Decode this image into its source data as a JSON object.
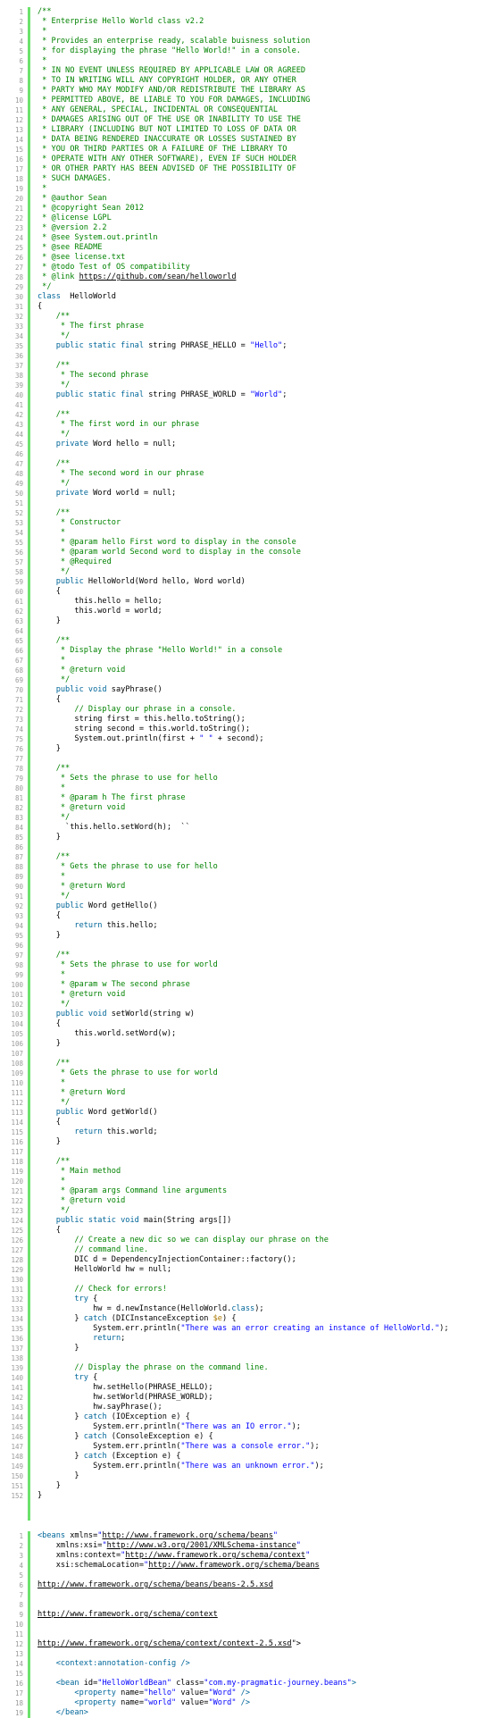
{
  "theme": {
    "gutter_bar": "#6ce26c",
    "line_number": "#9a9a9a",
    "comment": "#008200",
    "keyword": "#006699",
    "string": "#0000ff",
    "variable": "#aa7700"
  },
  "java": {
    "language": "java",
    "lines": [
      [
        [
          "cm",
          "/**"
        ]
      ],
      [
        [
          "cm",
          " * Enterprise Hello World class v2.2"
        ]
      ],
      [
        [
          "cm",
          " *"
        ]
      ],
      [
        [
          "cm",
          " * Provides an enterprise ready, scalable buisness solution"
        ]
      ],
      [
        [
          "cm",
          " * for displaying the phrase \"Hello World!\" in a console."
        ]
      ],
      [
        [
          "cm",
          " *"
        ]
      ],
      [
        [
          "cm",
          " * IN NO EVENT UNLESS REQUIRED BY APPLICABLE LAW OR AGREED"
        ]
      ],
      [
        [
          "cm",
          " * TO IN WRITING WILL ANY COPYRIGHT HOLDER, OR ANY OTHER"
        ]
      ],
      [
        [
          "cm",
          " * PARTY WHO MAY MODIFY AND/OR REDISTRIBUTE THE LIBRARY AS"
        ]
      ],
      [
        [
          "cm",
          " * PERMITTED ABOVE, BE LIABLE TO YOU FOR DAMAGES, INCLUDING"
        ]
      ],
      [
        [
          "cm",
          " * ANY GENERAL, SPECIAL, INCIDENTAL OR CONSEQUENTIAL"
        ]
      ],
      [
        [
          "cm",
          " * DAMAGES ARISING OUT OF THE USE OR INABILITY TO USE THE"
        ]
      ],
      [
        [
          "cm",
          " * LIBRARY (INCLUDING BUT NOT LIMITED TO LOSS OF DATA OR"
        ]
      ],
      [
        [
          "cm",
          " * DATA BEING RENDERED INACCURATE OR LOSSES SUSTAINED BY"
        ]
      ],
      [
        [
          "cm",
          " * YOU OR THIRD PARTIES OR A FAILURE OF THE LIBRARY TO"
        ]
      ],
      [
        [
          "cm",
          " * OPERATE WITH ANY OTHER SOFTWARE), EVEN IF SUCH HOLDER"
        ]
      ],
      [
        [
          "cm",
          " * OR OTHER PARTY HAS BEEN ADVISED OF THE POSSIBILITY OF"
        ]
      ],
      [
        [
          "cm",
          " * SUCH DAMAGES."
        ]
      ],
      [
        [
          "cm",
          " *"
        ]
      ],
      [
        [
          "cm",
          " * @author Sean"
        ]
      ],
      [
        [
          "cm",
          " * @copyright Sean 2012"
        ]
      ],
      [
        [
          "cm",
          " * @license LGPL"
        ]
      ],
      [
        [
          "cm",
          " * @version 2.2"
        ]
      ],
      [
        [
          "cm",
          " * @see System.out.println"
        ]
      ],
      [
        [
          "cm",
          " * @see README"
        ]
      ],
      [
        [
          "cm",
          " * @see license.txt"
        ]
      ],
      [
        [
          "cm",
          " * @todo Test of OS compatibility"
        ]
      ],
      [
        [
          "cm",
          " * @link "
        ],
        [
          "lk",
          "https://github.com/sean/helloworld"
        ]
      ],
      [
        [
          "cm",
          " */"
        ]
      ],
      [
        [
          "kw",
          "class"
        ],
        [
          "",
          "  HelloWorld"
        ]
      ],
      [
        [
          "",
          "{"
        ]
      ],
      [
        [
          "cm",
          "    /**"
        ]
      ],
      [
        [
          "cm",
          "     * The first phrase"
        ]
      ],
      [
        [
          "cm",
          "     */"
        ]
      ],
      [
        [
          "kw",
          "    public static final "
        ],
        [
          "",
          "string PHRASE_HELLO = "
        ],
        [
          "st",
          "\"Hello\""
        ],
        [
          "",
          ";"
        ]
      ],
      [
        [
          "",
          ""
        ]
      ],
      [
        [
          "cm",
          "    /**"
        ]
      ],
      [
        [
          "cm",
          "     * The second phrase"
        ]
      ],
      [
        [
          "cm",
          "     */"
        ]
      ],
      [
        [
          "kw",
          "    public static final "
        ],
        [
          "",
          "string PHRASE_WORLD = "
        ],
        [
          "st",
          "\"World\""
        ],
        [
          "",
          ";"
        ]
      ],
      [
        [
          "",
          ""
        ]
      ],
      [
        [
          "cm",
          "    /**"
        ]
      ],
      [
        [
          "cm",
          "     * The first word in our phrase"
        ]
      ],
      [
        [
          "cm",
          "     */"
        ]
      ],
      [
        [
          "kw",
          "    private "
        ],
        [
          "",
          "Word hello = null;"
        ]
      ],
      [
        [
          "",
          ""
        ]
      ],
      [
        [
          "cm",
          "    /**"
        ]
      ],
      [
        [
          "cm",
          "     * The second word in our phrase"
        ]
      ],
      [
        [
          "cm",
          "     */"
        ]
      ],
      [
        [
          "kw",
          "    private "
        ],
        [
          "",
          "Word world = null;"
        ]
      ],
      [
        [
          "",
          ""
        ]
      ],
      [
        [
          "cm",
          "    /**"
        ]
      ],
      [
        [
          "cm",
          "     * Constructor"
        ]
      ],
      [
        [
          "cm",
          "     *"
        ]
      ],
      [
        [
          "cm",
          "     * @param hello First word to display in the console"
        ]
      ],
      [
        [
          "cm",
          "     * @param world Second word to display in the console"
        ]
      ],
      [
        [
          "cm",
          "     * @Required"
        ]
      ],
      [
        [
          "cm",
          "     */"
        ]
      ],
      [
        [
          "kw",
          "    public "
        ],
        [
          "",
          "HelloWorld(Word hello, Word world)"
        ]
      ],
      [
        [
          "",
          "    {"
        ]
      ],
      [
        [
          "",
          "        this.hello = hello;"
        ]
      ],
      [
        [
          "",
          "        this.world = world;"
        ]
      ],
      [
        [
          "",
          "    }"
        ]
      ],
      [
        [
          "",
          ""
        ]
      ],
      [
        [
          "cm",
          "    /**"
        ]
      ],
      [
        [
          "cm",
          "     * Display the phrase \"Hello World!\" in a console"
        ]
      ],
      [
        [
          "cm",
          "     *"
        ]
      ],
      [
        [
          "cm",
          "     * @return void"
        ]
      ],
      [
        [
          "cm",
          "     */"
        ]
      ],
      [
        [
          "kw",
          "    public void "
        ],
        [
          "",
          "sayPhrase()"
        ]
      ],
      [
        [
          "",
          "    {"
        ]
      ],
      [
        [
          "cm",
          "        // Display our phrase in a console."
        ]
      ],
      [
        [
          "",
          "        string first = this.hello.toString();"
        ]
      ],
      [
        [
          "",
          "        string second = this.world.toString();"
        ]
      ],
      [
        [
          "",
          "        System.out.println(first + "
        ],
        [
          "st",
          "\" \""
        ],
        [
          "",
          "",
          " + second);"
        ]
      ],
      [
        [
          "",
          "    }"
        ]
      ],
      [
        [
          "",
          ""
        ]
      ],
      [
        [
          "cm",
          "    /**"
        ]
      ],
      [
        [
          "cm",
          "     * Sets the phrase to use for hello"
        ]
      ],
      [
        [
          "cm",
          "     *"
        ]
      ],
      [
        [
          "cm",
          "     * @param h The first phrase"
        ]
      ],
      [
        [
          "cm",
          "     * @return void"
        ]
      ],
      [
        [
          "cm",
          "     */"
        ]
      ],
      [
        [
          "",
          "      `this.hello.setWord(h);  ``"
        ]
      ],
      [
        [
          "",
          "    }"
        ]
      ],
      [
        [
          "",
          ""
        ]
      ],
      [
        [
          "cm",
          "    /**"
        ]
      ],
      [
        [
          "cm",
          "     * Gets the phrase to use for hello"
        ]
      ],
      [
        [
          "cm",
          "     *"
        ]
      ],
      [
        [
          "cm",
          "     * @return Word"
        ]
      ],
      [
        [
          "cm",
          "     */"
        ]
      ],
      [
        [
          "kw",
          "    public "
        ],
        [
          "",
          "Word getHello()"
        ]
      ],
      [
        [
          "",
          "    {"
        ]
      ],
      [
        [
          "kw",
          "        return "
        ],
        [
          "",
          "this.hello;"
        ]
      ],
      [
        [
          "",
          "    }"
        ]
      ],
      [
        [
          "",
          ""
        ]
      ],
      [
        [
          "cm",
          "    /**"
        ]
      ],
      [
        [
          "cm",
          "     * Sets the phrase to use for world"
        ]
      ],
      [
        [
          "cm",
          "     *"
        ]
      ],
      [
        [
          "cm",
          "     * @param w The second phrase"
        ]
      ],
      [
        [
          "cm",
          "     * @return void"
        ]
      ],
      [
        [
          "cm",
          "     */"
        ]
      ],
      [
        [
          "kw",
          "    public void "
        ],
        [
          "",
          "setWorld(string w)"
        ]
      ],
      [
        [
          "",
          "    {"
        ]
      ],
      [
        [
          "",
          "        this.world.setWord(w);"
        ]
      ],
      [
        [
          "",
          "    }"
        ]
      ],
      [
        [
          "",
          ""
        ]
      ],
      [
        [
          "cm",
          "    /**"
        ]
      ],
      [
        [
          "cm",
          "     * Gets the phrase to use for world"
        ]
      ],
      [
        [
          "cm",
          "     *"
        ]
      ],
      [
        [
          "cm",
          "     * @return Word"
        ]
      ],
      [
        [
          "cm",
          "     */"
        ]
      ],
      [
        [
          "kw",
          "    public "
        ],
        [
          "",
          "Word getWorld()"
        ]
      ],
      [
        [
          "",
          "    {"
        ]
      ],
      [
        [
          "kw",
          "        return "
        ],
        [
          "",
          "this.world;"
        ]
      ],
      [
        [
          "",
          "    }"
        ]
      ],
      [
        [
          "",
          ""
        ]
      ],
      [
        [
          "cm",
          "    /**"
        ]
      ],
      [
        [
          "cm",
          "     * Main method"
        ]
      ],
      [
        [
          "cm",
          "     *"
        ]
      ],
      [
        [
          "cm",
          "     * @param args Command line arguments"
        ]
      ],
      [
        [
          "cm",
          "     * @return void"
        ]
      ],
      [
        [
          "cm",
          "     */"
        ]
      ],
      [
        [
          "kw",
          "    public static void "
        ],
        [
          "",
          "main(String args[])"
        ]
      ],
      [
        [
          "",
          "    {"
        ]
      ],
      [
        [
          "cm",
          "        // Create a new dic so we can display our phrase on the"
        ]
      ],
      [
        [
          "cm",
          "        // command line."
        ]
      ],
      [
        [
          "",
          "        DIC d = DependencyInjectionContainer::factory();"
        ]
      ],
      [
        [
          "",
          "        HelloWorld hw = null;"
        ]
      ],
      [
        [
          "",
          ""
        ]
      ],
      [
        [
          "cm",
          "        // Check for errors!"
        ]
      ],
      [
        [
          "kw",
          "        try "
        ],
        [
          "",
          "{"
        ]
      ],
      [
        [
          "",
          "            hw = d.newInstance(HelloWorld."
        ],
        [
          "kw",
          "class"
        ],
        [
          "",
          ");"
        ]
      ],
      [
        [
          "",
          "        } "
        ],
        [
          "kw",
          "catch"
        ],
        [
          "",
          " (DICInstanceException "
        ],
        [
          "vr",
          "$e"
        ],
        [
          "",
          ") {"
        ]
      ],
      [
        [
          "",
          "            System.err.println("
        ],
        [
          "st",
          "\"There was an error creating an instance of HelloWorld.\""
        ],
        [
          "",
          ");"
        ]
      ],
      [
        [
          "kw",
          "            return"
        ],
        [
          "",
          ";"
        ]
      ],
      [
        [
          "",
          "        }"
        ]
      ],
      [
        [
          "",
          ""
        ]
      ],
      [
        [
          "cm",
          "        // Display the phrase on the command line."
        ]
      ],
      [
        [
          "kw",
          "        try "
        ],
        [
          "",
          "{"
        ]
      ],
      [
        [
          "",
          "            hw.setHello(PHRASE_HELLO);"
        ]
      ],
      [
        [
          "",
          "            hw.setWorld(PHRASE_WORLD);"
        ]
      ],
      [
        [
          "",
          "            hw.sayPhrase();"
        ]
      ],
      [
        [
          "",
          "        } "
        ],
        [
          "kw",
          "catch"
        ],
        [
          "",
          " (IOException e) {"
        ]
      ],
      [
        [
          "",
          "            System.err.println("
        ],
        [
          "st",
          "\"There was an IO error.\""
        ],
        [
          "",
          ");"
        ]
      ],
      [
        [
          "",
          "        } "
        ],
        [
          "kw",
          "catch"
        ],
        [
          "",
          " (ConsoleException e) {"
        ]
      ],
      [
        [
          "",
          "            System.err.println("
        ],
        [
          "st",
          "\"There was a console error.\""
        ],
        [
          "",
          ");"
        ]
      ],
      [
        [
          "",
          "        } "
        ],
        [
          "kw",
          "catch"
        ],
        [
          "",
          " (Exception e) {"
        ]
      ],
      [
        [
          "",
          "            System.err.println("
        ],
        [
          "st",
          "\"There was an unknown error.\""
        ],
        [
          "",
          ");"
        ]
      ],
      [
        [
          "",
          "        }"
        ]
      ],
      [
        [
          "",
          "    }"
        ]
      ],
      [
        [
          "",
          "}"
        ]
      ]
    ]
  },
  "xml": {
    "language": "xml",
    "lines": [
      [
        [
          "kw",
          "<beans "
        ],
        [
          "",
          "xmlns="
        ],
        [
          "st",
          "\""
        ],
        [
          "lk",
          "http://www.framework.org/schema/beans"
        ],
        [
          "st",
          "\""
        ]
      ],
      [
        [
          "",
          "    xmlns:xsi="
        ],
        [
          "st",
          "\""
        ],
        [
          "lk",
          "http://www.w3.org/2001/XMLSchema-instance"
        ],
        [
          "st",
          "\""
        ]
      ],
      [
        [
          "",
          "    xmlns:context="
        ],
        [
          "st",
          "\""
        ],
        [
          "lk",
          "http://www.framework.org/schema/context"
        ],
        [
          "st",
          "\""
        ]
      ],
      [
        [
          "",
          "    xsi:schemaLocation="
        ],
        [
          "st",
          "\""
        ],
        [
          "lk",
          "http://www.framework.org/schema/beans"
        ]
      ],
      [
        [
          "",
          ""
        ]
      ],
      [
        [
          "lk",
          "http://www.framework.org/schema/beans/beans-2.5.xsd"
        ]
      ],
      [
        [
          "",
          ""
        ]
      ],
      [
        [
          "",
          ""
        ]
      ],
      [
        [
          "lk",
          "http://www.framework.org/schema/context"
        ]
      ],
      [
        [
          "",
          ""
        ]
      ],
      [
        [
          "",
          ""
        ]
      ],
      [
        [
          "lk",
          "http://www.framework.org/schema/context/context-2.5.xsd"
        ],
        [
          "",
          "\">"
        ]
      ],
      [
        [
          "",
          ""
        ]
      ],
      [
        [
          "kw",
          "    <context:annotation-config "
        ],
        [
          "kw",
          "/>"
        ]
      ],
      [
        [
          "",
          ""
        ]
      ],
      [
        [
          "kw",
          "    <bean "
        ],
        [
          "",
          "id="
        ],
        [
          "st",
          "\"HelloWorldBean\""
        ],
        [
          "",
          " class="
        ],
        [
          "st",
          "\"com.my-pragmatic-journey.beans\""
        ],
        [
          "kw",
          ">"
        ]
      ],
      [
        [
          "kw",
          "        <property "
        ],
        [
          "",
          "name="
        ],
        [
          "st",
          "\"hello\""
        ],
        [
          "",
          " value="
        ],
        [
          "st",
          "\"Word\""
        ],
        [
          "kw",
          " />"
        ]
      ],
      [
        [
          "kw",
          "        <property "
        ],
        [
          "",
          "name="
        ],
        [
          "st",
          "\"world\""
        ],
        [
          "",
          " value="
        ],
        [
          "st",
          "\"Word\""
        ],
        [
          "kw",
          " />"
        ]
      ],
      [
        [
          "kw",
          "    </bean>"
        ]
      ]
    ]
  }
}
